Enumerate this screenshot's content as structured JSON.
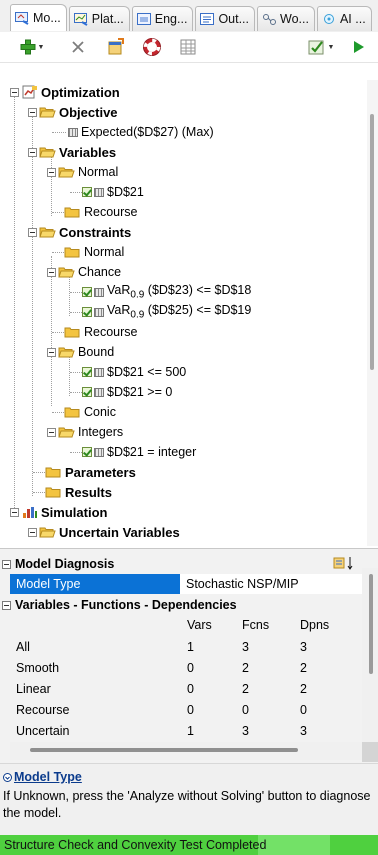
{
  "tabs": [
    {
      "label": "Mo..."
    },
    {
      "label": "Plat..."
    },
    {
      "label": "Eng..."
    },
    {
      "label": "Out..."
    },
    {
      "label": "Wo..."
    },
    {
      "label": "AI ..."
    }
  ],
  "toolbar": {
    "add_icon": "plus-icon",
    "delete_icon": "x-icon",
    "refresh_icon": "refresh-icon",
    "lifesaver_icon": "lifesaver-icon",
    "grid_icon": "grid-icon",
    "check_icon": "check-list-icon",
    "run_icon": "play-icon"
  },
  "tree": {
    "optimization": "Optimization",
    "objective": "Objective",
    "objective_item": "Expected($D$27) (Max)",
    "variables": "Variables",
    "var_normal": "Normal",
    "var_item": "$D$21",
    "var_recourse": "Recourse",
    "constraints": "Constraints",
    "con_normal": "Normal",
    "con_chance": "Chance",
    "chance1": {
      "pre": "VaR",
      "sub": "0.9",
      "post": "($D$23) <= $D$18"
    },
    "chance2": {
      "pre": "VaR",
      "sub": "0.9",
      "post": "($D$25) <= $D$19"
    },
    "con_recourse": "Recourse",
    "bound": "Bound",
    "bound1": "$D$21 <= 500",
    "bound2": "$D$21 >= 0",
    "conic": "Conic",
    "integers": "Integers",
    "int1": "$D$21 = integer",
    "parameters": "Parameters",
    "results": "Results",
    "simulation": "Simulation",
    "uncertain_variables": "Uncertain Variables"
  },
  "properties": {
    "cat1": "Model Diagnosis",
    "model_type_label": "Model Type",
    "model_type_value": "Stochastic NSP/MIP",
    "cat2": "Variables - Functions - Dependencies",
    "columns": [
      "Vars",
      "Fcns",
      "Dpns"
    ],
    "rows": [
      {
        "label": "All",
        "vars": "1",
        "fcns": "3",
        "dpns": "3"
      },
      {
        "label": "Smooth",
        "vars": "0",
        "fcns": "2",
        "dpns": "2"
      },
      {
        "label": "Linear",
        "vars": "0",
        "fcns": "2",
        "dpns": "2"
      },
      {
        "label": "Recourse",
        "vars": "0",
        "fcns": "0",
        "dpns": "0"
      },
      {
        "label": "Uncertain",
        "vars": "1",
        "fcns": "3",
        "dpns": "3"
      }
    ]
  },
  "help": {
    "title": "Model Type",
    "text": "If Unknown, press the 'Analyze without Solving' button to diagnose the model."
  },
  "status": {
    "text": "Structure Check and Convexity Test Completed",
    "color": "#4fd03f"
  },
  "colors": {
    "selection": "#0b72d6",
    "folder": "#f3c440",
    "accent_green": "#2f8a1f"
  }
}
